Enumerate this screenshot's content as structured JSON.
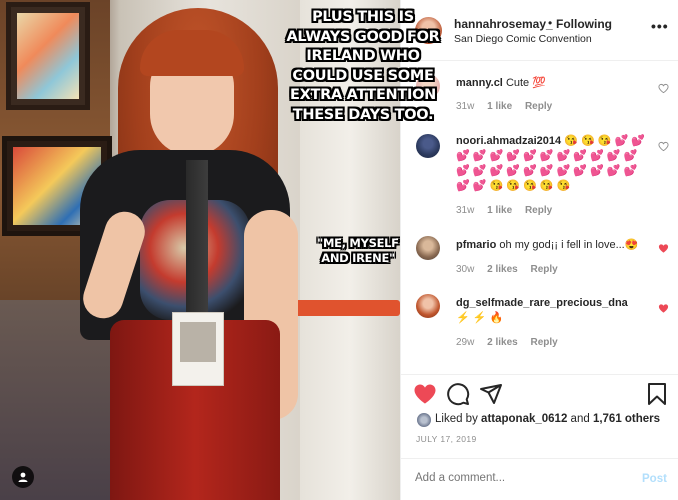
{
  "meme": {
    "top_text": "PLUS THIS IS ALWAYS GOOD FOR IRELAND WHO COULD USE SOME EXTRA ATTENTION THESE DAYS TOO.",
    "mid_text": "\"ME, MYSELF AND IRENE\""
  },
  "header": {
    "username": "hannahrosemay_",
    "separator": "•",
    "follow_status": "Following",
    "location": "San Diego Comic Convention",
    "more_icon": "more-horizontal-icon"
  },
  "comments": [
    {
      "username": "manny.cl",
      "text": "Cute 💯",
      "age": "31w",
      "likes": "1 like",
      "reply": "Reply",
      "liked": false
    },
    {
      "username": "noori.ahmadzai2014",
      "text": "😘 😘 😘 💕 💕 💕 💕 💕 💕 💕 💕 💕 💕 💕 💕 💕 💕 💕 💕 💕 💕 💕 💕 💕 💕 💕 💕 💕 💕 😘 😘 😘 😘 😘",
      "age": "31w",
      "likes": "1 like",
      "reply": "Reply",
      "liked": false
    },
    {
      "username": "pfmario",
      "text": "oh my god¡¡ i fell in love...😍",
      "age": "30w",
      "likes": "2 likes",
      "reply": "Reply",
      "liked": true
    },
    {
      "username": "dg_selfmade_rare_precious_dna",
      "text": "⚡ ⚡ 🔥",
      "age": "29w",
      "likes": "2 likes",
      "reply": "Reply",
      "liked": true
    }
  ],
  "likes_summary": {
    "prefix": "Liked by",
    "user": "attaponak_0612",
    "and": "and",
    "others": "1,761 others"
  },
  "date": "JULY 17, 2019",
  "add_comment": {
    "placeholder": "Add a comment...",
    "post_label": "Post"
  },
  "colors": {
    "like_red": "#ed4956",
    "post_disabled": "#b2dffc",
    "meta_gray": "#8e8e8e"
  }
}
